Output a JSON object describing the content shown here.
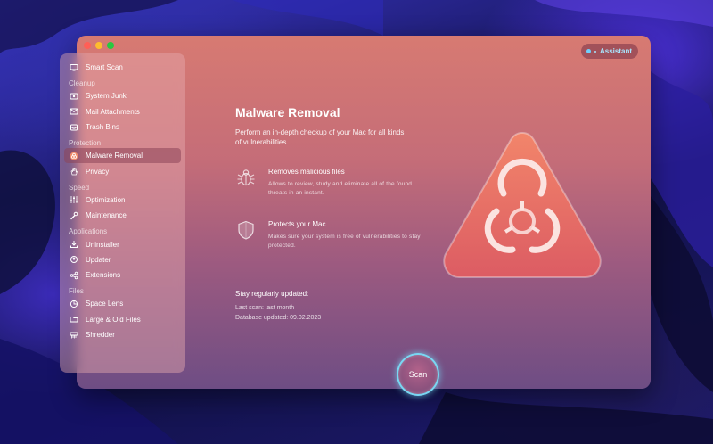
{
  "colors": {
    "window_top": "#d77a72",
    "window_bottom": "#6e4d84",
    "assistant_text": "#a8e6ff",
    "scan_ring": "#78e6ff",
    "hero_triangle": "#e96a60"
  },
  "window": {
    "assistant_label": "Assistant"
  },
  "sidebar": {
    "top_item": {
      "label": "Smart Scan",
      "icon": "monitor-icon"
    },
    "sections": [
      {
        "title": "Cleanup",
        "items": [
          {
            "label": "System Junk",
            "icon": "disk-icon"
          },
          {
            "label": "Mail Attachments",
            "icon": "envelope-icon"
          },
          {
            "label": "Trash Bins",
            "icon": "trash-icon"
          }
        ]
      },
      {
        "title": "Protection",
        "items": [
          {
            "label": "Malware Removal",
            "icon": "biohazard-icon",
            "active": true
          },
          {
            "label": "Privacy",
            "icon": "hand-icon"
          }
        ]
      },
      {
        "title": "Speed",
        "items": [
          {
            "label": "Optimization",
            "icon": "sliders-icon"
          },
          {
            "label": "Maintenance",
            "icon": "wrench-icon"
          }
        ]
      },
      {
        "title": "Applications",
        "items": [
          {
            "label": "Uninstaller",
            "icon": "uninstall-icon"
          },
          {
            "label": "Updater",
            "icon": "update-icon"
          },
          {
            "label": "Extensions",
            "icon": "share-icon"
          }
        ]
      },
      {
        "title": "Files",
        "items": [
          {
            "label": "Space Lens",
            "icon": "lens-icon"
          },
          {
            "label": "Large & Old Files",
            "icon": "folder-icon"
          },
          {
            "label": "Shredder",
            "icon": "shredder-icon"
          }
        ]
      }
    ]
  },
  "main": {
    "title": "Malware Removal",
    "description": "Perform an in-depth checkup of your Mac for all kinds of vulnerabilities.",
    "features": [
      {
        "title": "Removes malicious files",
        "desc": "Allows to review, study and eliminate all of the found threats in an instant.",
        "icon": "bug-icon"
      },
      {
        "title": "Protects your Mac",
        "desc": "Makes sure your system is free of vulnerabilities to stay protected.",
        "icon": "shield-icon"
      }
    ],
    "updated": {
      "title": "Stay regularly updated:",
      "last_scan": "Last scan: last month",
      "database": "Database updated: 09.02.2023"
    },
    "scan_label": "Scan"
  }
}
